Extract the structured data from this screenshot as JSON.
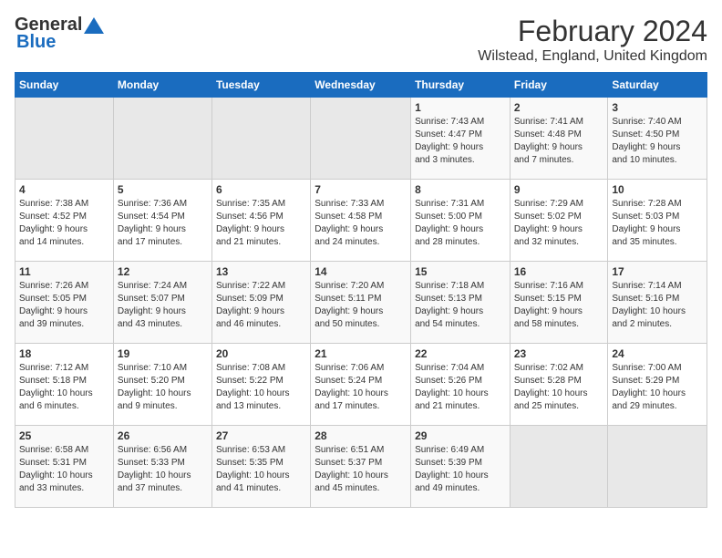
{
  "logo": {
    "general": "General",
    "blue": "Blue"
  },
  "title": {
    "month": "February 2024",
    "location": "Wilstead, England, United Kingdom"
  },
  "headers": [
    "Sunday",
    "Monday",
    "Tuesday",
    "Wednesday",
    "Thursday",
    "Friday",
    "Saturday"
  ],
  "weeks": [
    [
      {
        "day": "",
        "info": ""
      },
      {
        "day": "",
        "info": ""
      },
      {
        "day": "",
        "info": ""
      },
      {
        "day": "",
        "info": ""
      },
      {
        "day": "1",
        "info": "Sunrise: 7:43 AM\nSunset: 4:47 PM\nDaylight: 9 hours\nand 3 minutes."
      },
      {
        "day": "2",
        "info": "Sunrise: 7:41 AM\nSunset: 4:48 PM\nDaylight: 9 hours\nand 7 minutes."
      },
      {
        "day": "3",
        "info": "Sunrise: 7:40 AM\nSunset: 4:50 PM\nDaylight: 9 hours\nand 10 minutes."
      }
    ],
    [
      {
        "day": "4",
        "info": "Sunrise: 7:38 AM\nSunset: 4:52 PM\nDaylight: 9 hours\nand 14 minutes."
      },
      {
        "day": "5",
        "info": "Sunrise: 7:36 AM\nSunset: 4:54 PM\nDaylight: 9 hours\nand 17 minutes."
      },
      {
        "day": "6",
        "info": "Sunrise: 7:35 AM\nSunset: 4:56 PM\nDaylight: 9 hours\nand 21 minutes."
      },
      {
        "day": "7",
        "info": "Sunrise: 7:33 AM\nSunset: 4:58 PM\nDaylight: 9 hours\nand 24 minutes."
      },
      {
        "day": "8",
        "info": "Sunrise: 7:31 AM\nSunset: 5:00 PM\nDaylight: 9 hours\nand 28 minutes."
      },
      {
        "day": "9",
        "info": "Sunrise: 7:29 AM\nSunset: 5:02 PM\nDaylight: 9 hours\nand 32 minutes."
      },
      {
        "day": "10",
        "info": "Sunrise: 7:28 AM\nSunset: 5:03 PM\nDaylight: 9 hours\nand 35 minutes."
      }
    ],
    [
      {
        "day": "11",
        "info": "Sunrise: 7:26 AM\nSunset: 5:05 PM\nDaylight: 9 hours\nand 39 minutes."
      },
      {
        "day": "12",
        "info": "Sunrise: 7:24 AM\nSunset: 5:07 PM\nDaylight: 9 hours\nand 43 minutes."
      },
      {
        "day": "13",
        "info": "Sunrise: 7:22 AM\nSunset: 5:09 PM\nDaylight: 9 hours\nand 46 minutes."
      },
      {
        "day": "14",
        "info": "Sunrise: 7:20 AM\nSunset: 5:11 PM\nDaylight: 9 hours\nand 50 minutes."
      },
      {
        "day": "15",
        "info": "Sunrise: 7:18 AM\nSunset: 5:13 PM\nDaylight: 9 hours\nand 54 minutes."
      },
      {
        "day": "16",
        "info": "Sunrise: 7:16 AM\nSunset: 5:15 PM\nDaylight: 9 hours\nand 58 minutes."
      },
      {
        "day": "17",
        "info": "Sunrise: 7:14 AM\nSunset: 5:16 PM\nDaylight: 10 hours\nand 2 minutes."
      }
    ],
    [
      {
        "day": "18",
        "info": "Sunrise: 7:12 AM\nSunset: 5:18 PM\nDaylight: 10 hours\nand 6 minutes."
      },
      {
        "day": "19",
        "info": "Sunrise: 7:10 AM\nSunset: 5:20 PM\nDaylight: 10 hours\nand 9 minutes."
      },
      {
        "day": "20",
        "info": "Sunrise: 7:08 AM\nSunset: 5:22 PM\nDaylight: 10 hours\nand 13 minutes."
      },
      {
        "day": "21",
        "info": "Sunrise: 7:06 AM\nSunset: 5:24 PM\nDaylight: 10 hours\nand 17 minutes."
      },
      {
        "day": "22",
        "info": "Sunrise: 7:04 AM\nSunset: 5:26 PM\nDaylight: 10 hours\nand 21 minutes."
      },
      {
        "day": "23",
        "info": "Sunrise: 7:02 AM\nSunset: 5:28 PM\nDaylight: 10 hours\nand 25 minutes."
      },
      {
        "day": "24",
        "info": "Sunrise: 7:00 AM\nSunset: 5:29 PM\nDaylight: 10 hours\nand 29 minutes."
      }
    ],
    [
      {
        "day": "25",
        "info": "Sunrise: 6:58 AM\nSunset: 5:31 PM\nDaylight: 10 hours\nand 33 minutes."
      },
      {
        "day": "26",
        "info": "Sunrise: 6:56 AM\nSunset: 5:33 PM\nDaylight: 10 hours\nand 37 minutes."
      },
      {
        "day": "27",
        "info": "Sunrise: 6:53 AM\nSunset: 5:35 PM\nDaylight: 10 hours\nand 41 minutes."
      },
      {
        "day": "28",
        "info": "Sunrise: 6:51 AM\nSunset: 5:37 PM\nDaylight: 10 hours\nand 45 minutes."
      },
      {
        "day": "29",
        "info": "Sunrise: 6:49 AM\nSunset: 5:39 PM\nDaylight: 10 hours\nand 49 minutes."
      },
      {
        "day": "",
        "info": ""
      },
      {
        "day": "",
        "info": ""
      }
    ]
  ]
}
